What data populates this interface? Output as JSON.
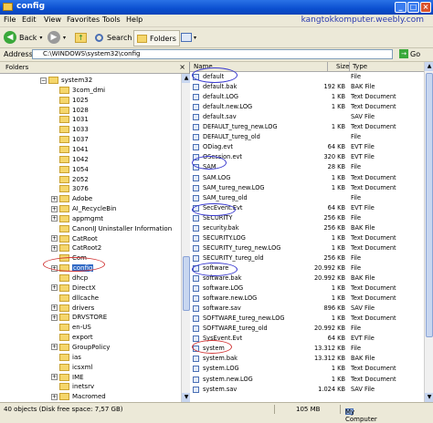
{
  "window": {
    "title": "config",
    "brand": "kangtokkomputer.weebly.com"
  },
  "menu": [
    "File",
    "Edit",
    "View",
    "Favorites",
    "Tools",
    "Help"
  ],
  "toolbar": {
    "back": "Back",
    "search": "Search",
    "folders": "Folders"
  },
  "address": {
    "label": "Address",
    "value": "C:\\WINDOWS\\system32\\config",
    "go": "Go"
  },
  "folders_pane": {
    "title": "Folders",
    "close": "×"
  },
  "tree": [
    {
      "label": "system32",
      "exp": "−",
      "indent": 0
    },
    {
      "label": "3com_dmi",
      "exp": "",
      "indent": 1
    },
    {
      "label": "1025",
      "exp": "",
      "indent": 1
    },
    {
      "label": "1028",
      "exp": "",
      "indent": 1
    },
    {
      "label": "1031",
      "exp": "",
      "indent": 1
    },
    {
      "label": "1033",
      "exp": "",
      "indent": 1
    },
    {
      "label": "1037",
      "exp": "",
      "indent": 1
    },
    {
      "label": "1041",
      "exp": "",
      "indent": 1
    },
    {
      "label": "1042",
      "exp": "",
      "indent": 1
    },
    {
      "label": "1054",
      "exp": "",
      "indent": 1
    },
    {
      "label": "2052",
      "exp": "",
      "indent": 1
    },
    {
      "label": "3076",
      "exp": "",
      "indent": 1
    },
    {
      "label": "Adobe",
      "exp": "+",
      "indent": 1
    },
    {
      "label": "AI_RecycleBin",
      "exp": "+",
      "indent": 1
    },
    {
      "label": "appmgmt",
      "exp": "+",
      "indent": 1
    },
    {
      "label": "CanonIJ Uninstaller Information",
      "exp": "",
      "indent": 1
    },
    {
      "label": "CatRoot",
      "exp": "+",
      "indent": 1
    },
    {
      "label": "CatRoot2",
      "exp": "+",
      "indent": 1
    },
    {
      "label": "Com",
      "exp": "",
      "indent": 1
    },
    {
      "label": "config",
      "exp": "+",
      "indent": 1,
      "selected": true
    },
    {
      "label": "dhcp",
      "exp": "",
      "indent": 1
    },
    {
      "label": "DirectX",
      "exp": "+",
      "indent": 1
    },
    {
      "label": "dllcache",
      "exp": "",
      "indent": 1
    },
    {
      "label": "drivers",
      "exp": "+",
      "indent": 1
    },
    {
      "label": "DRVSTORE",
      "exp": "+",
      "indent": 1
    },
    {
      "label": "en-US",
      "exp": "",
      "indent": 1
    },
    {
      "label": "export",
      "exp": "",
      "indent": 1
    },
    {
      "label": "GroupPolicy",
      "exp": "+",
      "indent": 1
    },
    {
      "label": "ias",
      "exp": "",
      "indent": 1
    },
    {
      "label": "icsxml",
      "exp": "",
      "indent": 1
    },
    {
      "label": "IME",
      "exp": "+",
      "indent": 1
    },
    {
      "label": "inetsrv",
      "exp": "",
      "indent": 1
    },
    {
      "label": "Macromed",
      "exp": "+",
      "indent": 1
    }
  ],
  "columns": {
    "name": "Name",
    "size": "Size",
    "type": "Type"
  },
  "files": [
    {
      "name": "default",
      "size": "",
      "type": "File"
    },
    {
      "name": "default.bak",
      "size": "192 KB",
      "type": "BAK File"
    },
    {
      "name": "default.LOG",
      "size": "1 KB",
      "type": "Text Document"
    },
    {
      "name": "default.new.LOG",
      "size": "1 KB",
      "type": "Text Document"
    },
    {
      "name": "default.sav",
      "size": "",
      "type": "SAV File"
    },
    {
      "name": "DEFAULT_tureg_new.LOG",
      "size": "1 KB",
      "type": "Text Document"
    },
    {
      "name": "DEFAULT_tureg_old",
      "size": "",
      "type": "File"
    },
    {
      "name": "ODiag.evt",
      "size": "64 KB",
      "type": "EVT File"
    },
    {
      "name": "OSession.evt",
      "size": "320 KB",
      "type": "EVT File"
    },
    {
      "name": "SAM",
      "size": "28 KB",
      "type": "File"
    },
    {
      "name": "SAM.LOG",
      "size": "1 KB",
      "type": "Text Document"
    },
    {
      "name": "SAM_tureg_new.LOG",
      "size": "1 KB",
      "type": "Text Document"
    },
    {
      "name": "SAM_tureg_old",
      "size": "",
      "type": "File"
    },
    {
      "name": "SecEvent.Evt",
      "size": "64 KB",
      "type": "EVT File"
    },
    {
      "name": "SECURITY",
      "size": "256 KB",
      "type": "File"
    },
    {
      "name": "security.bak",
      "size": "256 KB",
      "type": "BAK File"
    },
    {
      "name": "SECURITY.LOG",
      "size": "1 KB",
      "type": "Text Document"
    },
    {
      "name": "SECURITY_tureg_new.LOG",
      "size": "1 KB",
      "type": "Text Document"
    },
    {
      "name": "SECURITY_tureg_old",
      "size": "256 KB",
      "type": "File"
    },
    {
      "name": "software",
      "size": "20.992 KB",
      "type": "File"
    },
    {
      "name": "software.bak",
      "size": "20.992 KB",
      "type": "BAK File"
    },
    {
      "name": "software.LOG",
      "size": "1 KB",
      "type": "Text Document"
    },
    {
      "name": "software.new.LOG",
      "size": "1 KB",
      "type": "Text Document"
    },
    {
      "name": "software.sav",
      "size": "896 KB",
      "type": "SAV File"
    },
    {
      "name": "SOFTWARE_tureg_new.LOG",
      "size": "1 KB",
      "type": "Text Document"
    },
    {
      "name": "SOFTWARE_tureg_old",
      "size": "20.992 KB",
      "type": "File"
    },
    {
      "name": "SysEvent.Evt",
      "size": "64 KB",
      "type": "EVT File"
    },
    {
      "name": "system",
      "size": "13.312 KB",
      "type": "File"
    },
    {
      "name": "system.bak",
      "size": "13.312 KB",
      "type": "BAK File"
    },
    {
      "name": "system.LOG",
      "size": "1 KB",
      "type": "Text Document"
    },
    {
      "name": "system.new.LOG",
      "size": "1 KB",
      "type": "Text Document"
    },
    {
      "name": "system.sav",
      "size": "1.024 KB",
      "type": "SAV File"
    }
  ],
  "status": {
    "objects": "40 objects (Disk free space: 7,57 GB)",
    "size": "105 MB",
    "location": "My Computer"
  },
  "colors": {
    "title": "#0b4fd0",
    "selection": "#316ac5",
    "ring_blue": "#3a3ad0",
    "ring_red": "#d23a3a"
  }
}
